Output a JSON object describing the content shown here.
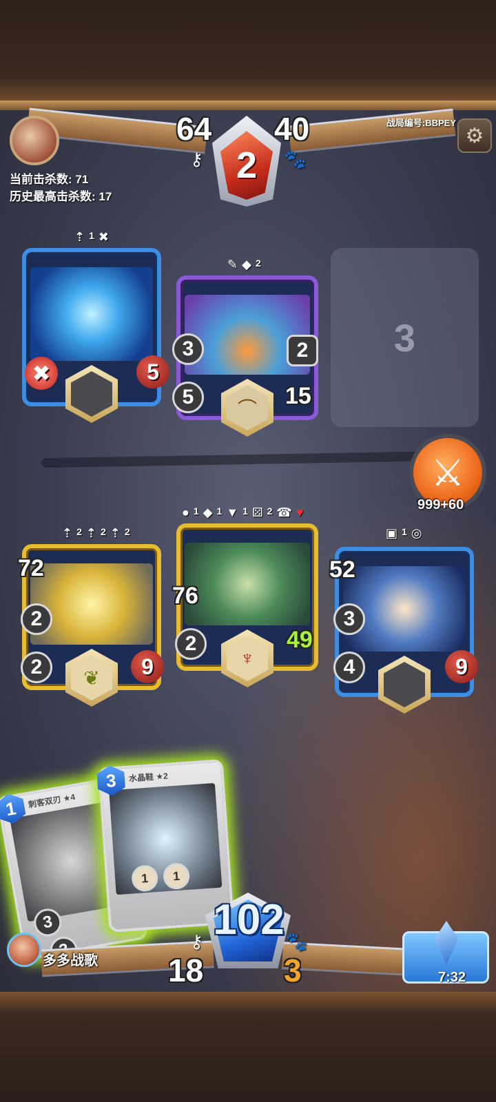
{
  "hud": {
    "kills_label": "当前击杀数: 71",
    "best_label": "历史最高击杀数: 17",
    "match_id": "战局编号:BBPEY",
    "opponent_gold": "64",
    "opponent_food": "40",
    "round": "2",
    "player_gold": "18",
    "player_food": "3",
    "crystal": "102",
    "player_name": "多多战歌",
    "timer": "7:32"
  },
  "attack": {
    "label": "999+60"
  },
  "enemy_cards": [
    {
      "tags": [
        "1"
      ],
      "health": "5",
      "color": "blue"
    },
    {
      "tags": [
        "2"
      ],
      "attack": "3",
      "shield": "2",
      "sword": "5",
      "health": "15",
      "color": "purple"
    }
  ],
  "empty_slot": {
    "label": "3"
  },
  "player_cards": [
    {
      "tags": [
        "2",
        "2",
        "2"
      ],
      "a": "72",
      "b": "2",
      "c": "2",
      "health": "9",
      "color": "gold"
    },
    {
      "tags": [
        "1",
        "1",
        "1",
        "2"
      ],
      "a": "76",
      "b": "2",
      "health": "49",
      "color": "gold"
    },
    {
      "tags": [
        "1"
      ],
      "a": "52",
      "b": "3",
      "c": "4",
      "health": "9",
      "color": "blue"
    }
  ],
  "hand": [
    {
      "name": "刺客双刃 ★4",
      "cost": "1",
      "stat1": "3",
      "stat2": "3"
    },
    {
      "name": "水晶鞋 ★2",
      "cost": "3",
      "chip1": "1",
      "chip2": "1"
    }
  ]
}
